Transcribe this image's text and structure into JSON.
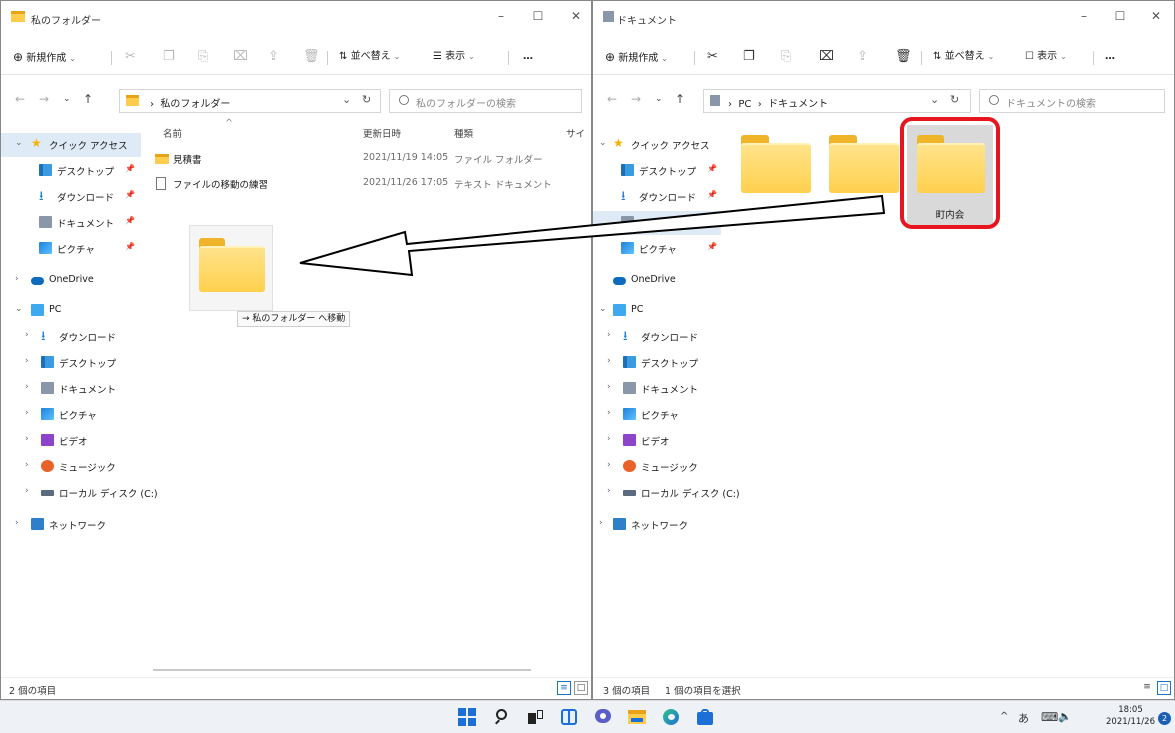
{
  "left_window": {
    "title": "私のフォルダー",
    "toolbar": {
      "new": "新規作成",
      "sort": "並べ替え",
      "view": "表示",
      "more": "…"
    },
    "address": "私のフォルダー",
    "search_placeholder": "私のフォルダーの検索",
    "columns": {
      "name": "名前",
      "modified": "更新日時",
      "type": "種類",
      "size": "サイ"
    },
    "files": [
      {
        "name": "見積書",
        "modified": "2021/11/19 14:05",
        "type": "ファイル フォルダー"
      },
      {
        "name": "ファイルの移動の練習",
        "modified": "2021/11/26 17:05",
        "type": "テキスト ドキュメント"
      }
    ],
    "drag_tooltip": "→ 私のフォルダー へ移動",
    "status": "2 個の項目"
  },
  "right_window": {
    "title": "ドキュメント",
    "toolbar": {
      "new": "新規作成",
      "sort": "並べ替え",
      "view": "表示",
      "more": "…"
    },
    "address_parts": [
      "PC",
      "ドキュメント"
    ],
    "search_placeholder": "ドキュメントの検索",
    "selected_folder_label": "町内会",
    "status_count": "3 個の項目",
    "status_selected": "1 個の項目を選択"
  },
  "nav": {
    "quick_access": "クイック アクセス",
    "desktop": "デスクトップ",
    "downloads": "ダウンロード",
    "documents": "ドキュメント",
    "pictures": "ピクチャ",
    "onedrive": "OneDrive",
    "pc": "PC",
    "videos": "ビデオ",
    "music": "ミュージック",
    "local_disk": "ローカル ディスク (C:)",
    "network": "ネットワーク"
  },
  "taskbar": {
    "tray_caret": "^",
    "ime": "あ",
    "time": "18:05",
    "date": "2021/11/26",
    "notifications": "2"
  },
  "colors": {
    "highlight_red": "#e8141e",
    "folder_yellow": "#ffd04d",
    "selection_blue": "#dfeaf7"
  }
}
